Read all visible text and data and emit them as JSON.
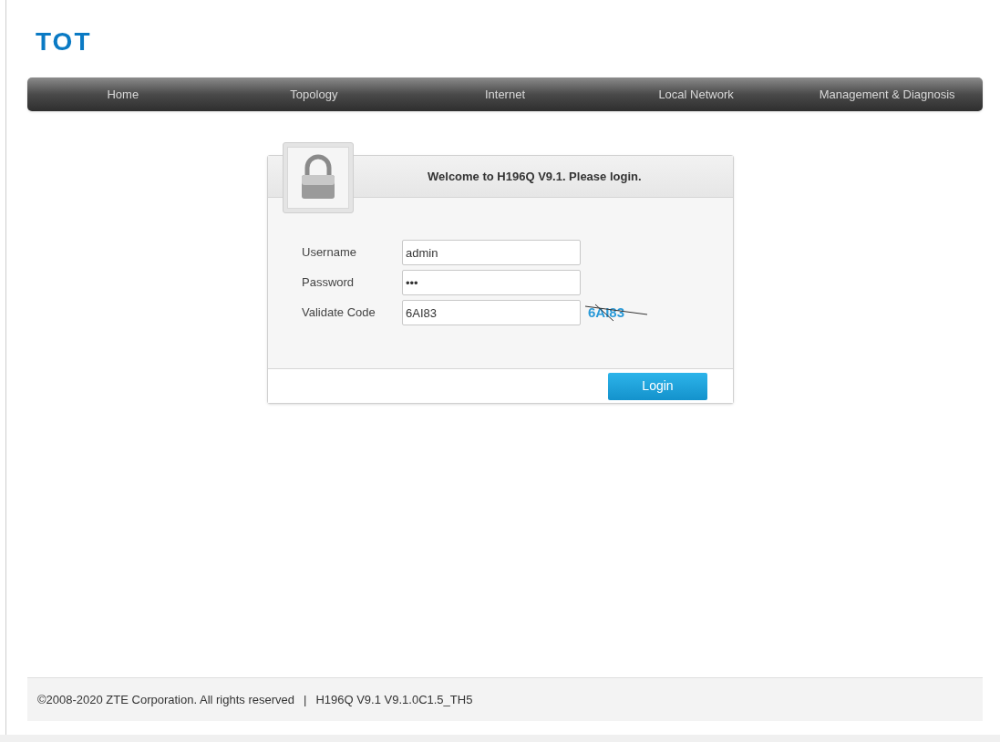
{
  "logo": {
    "text": "TOT"
  },
  "nav": [
    {
      "label": "Home"
    },
    {
      "label": "Topology"
    },
    {
      "label": "Internet"
    },
    {
      "label": "Local Network"
    },
    {
      "label": "Management & Diagnosis"
    }
  ],
  "login": {
    "title": "Welcome to H196Q V9.1. Please login.",
    "fields": [
      {
        "label": "Username",
        "value": "admin"
      },
      {
        "label": "Password",
        "value": "•••"
      },
      {
        "label": "Validate Code",
        "value": "6AI83",
        "captcha": "6AI83"
      }
    ],
    "button": "Login"
  },
  "footer": {
    "copyright": "©2008-2020 ZTE Corporation. All rights reserved",
    "separator": "|",
    "version": "H196Q V9.1 V9.1.0C1.5_TH5"
  }
}
